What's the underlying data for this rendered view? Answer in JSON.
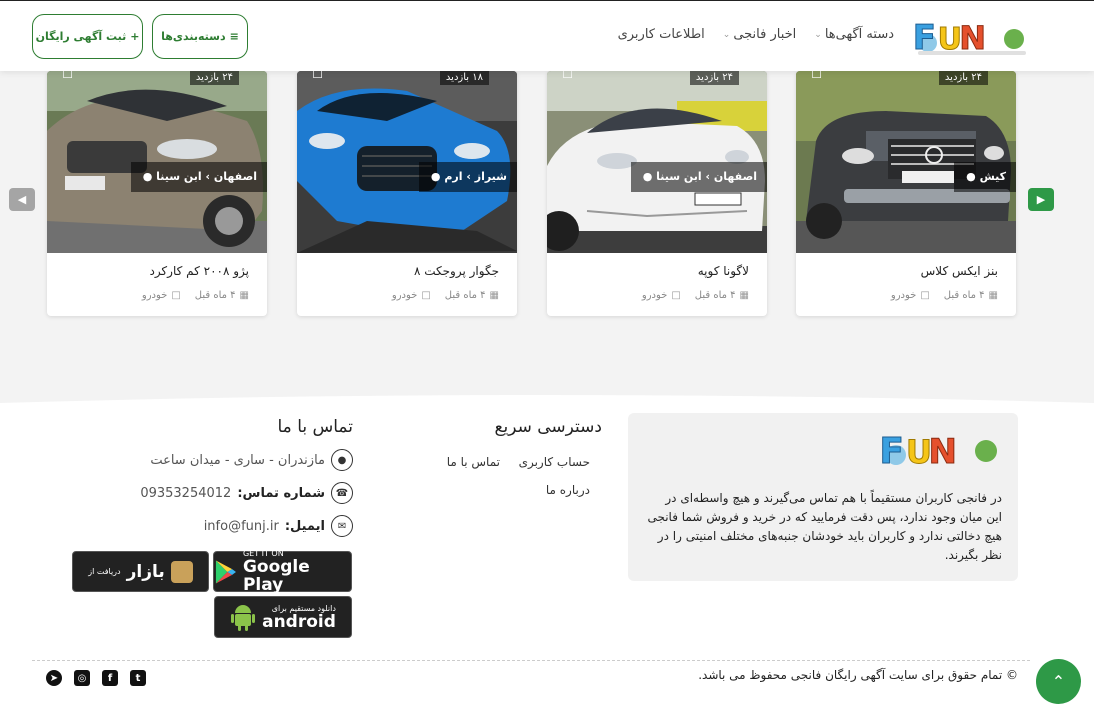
{
  "header": {
    "logo_text": "FUN",
    "nav": [
      {
        "label": "دسته آگهی‌ها",
        "has_dropdown": true
      },
      {
        "label": "اخبار فانجی",
        "has_dropdown": true
      },
      {
        "label": "اطلاعات کاربری",
        "has_dropdown": false
      }
    ],
    "categories_button": "دسته‌بندی‌ها",
    "post_ad_button": "ثبت آگهی رایگان"
  },
  "cards": [
    {
      "views": "۲۴ بازدید",
      "location": "کیش",
      "title": "بنز ایکس کلاس",
      "time": "۴ ماه قبل",
      "category": "خودرو",
      "image": "dark-pickup-truck"
    },
    {
      "views": "۲۴ بازدید",
      "location": "اصفهان › ابن سینا",
      "title": "لاگونا کوپه",
      "time": "۴ ماه قبل",
      "category": "خودرو",
      "image": "white-coupe"
    },
    {
      "views": "۱۸ بازدید",
      "location": "شیراز › ارم",
      "title": "جگوار پروجکت ۸",
      "time": "۴ ماه قبل",
      "category": "خودرو",
      "image": "blue-sports-car"
    },
    {
      "views": "۲۴ بازدید",
      "location": "اصفهان › ابن سینا",
      "title": "پژو ۲۰۰۸ کم کارکرد",
      "time": "۴ ماه قبل",
      "category": "خودرو",
      "image": "grey-hatchback"
    }
  ],
  "footer": {
    "about_text": "در فانجی کاربران مستقیماً با هم تماس می‌گیرند و هیچ واسطه‌ای در این میان وجود ندارد، پس دقت فرمایید که در خرید و فروش شما فانجی هیچ دخالتی ندارد و کاربران باید خودشان جنبه‌های مختلف امنیتی را در نظر بگیرند.",
    "quick_title": "دسترسی سریع",
    "quick_links": [
      "حساب کاربری",
      "تماس با ما",
      "درباره ما"
    ],
    "contact_title": "تماس با ما",
    "address": "مازندران - ساری - میدان ساعت",
    "phone_label": "شماره تماس:",
    "phone": "09353254012",
    "email_label": "ایمیل:",
    "email": "info@funj.ir",
    "stores": {
      "google_small": "GET IT ON",
      "google_big": "Google Play",
      "bazaar_small": "دریافت از",
      "bazaar_big": "بازار",
      "android_small": "دانلود مستقیم برای",
      "android_big": "android"
    },
    "copyright": "© تمام حقوق برای سایت آگهی رایگان فانجی محفوظ می باشد."
  },
  "colors": {
    "accent": "#2e9947",
    "brand_green": "#2e7d32"
  }
}
